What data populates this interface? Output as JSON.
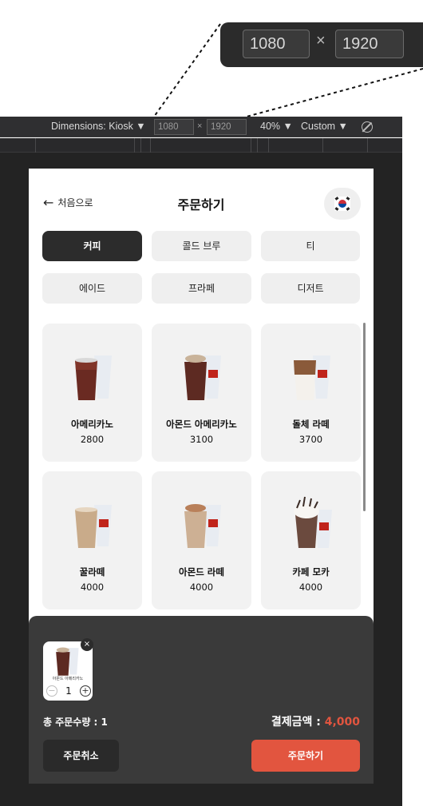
{
  "callout": {
    "width": "1080",
    "times": "×",
    "height": "1920"
  },
  "devtools": {
    "dimensions_label": "Dimensions: Kiosk ▼",
    "width": "1080",
    "times": "×",
    "height": "1920",
    "zoom": "40% ▼",
    "throttle": "Custom ▼"
  },
  "kiosk": {
    "back_label": "처음으로",
    "back_icon": "←",
    "title": "주문하기",
    "language_icon": "korea-flag-icon",
    "tabs": [
      {
        "label": "커피",
        "active": true
      },
      {
        "label": "콜드 브루",
        "active": false
      },
      {
        "label": "티",
        "active": false
      },
      {
        "label": "에이드",
        "active": false
      },
      {
        "label": "프라페",
        "active": false
      },
      {
        "label": "디저트",
        "active": false
      }
    ],
    "products": [
      {
        "name": "아메리카노",
        "price": "2800"
      },
      {
        "name": "아몬드 아메리카노",
        "price": "3100"
      },
      {
        "name": "돌체 라떼",
        "price": "3700"
      },
      {
        "name": "꿀라떼",
        "price": "4000"
      },
      {
        "name": "아몬드 라떼",
        "price": "4000"
      },
      {
        "name": "카페 모카",
        "price": "4000"
      }
    ],
    "cart": {
      "items": [
        {
          "name": "아몬드 아메리카노",
          "qty": "1",
          "minus": "−",
          "plus": "+",
          "remove": "×"
        }
      ],
      "total_count_label": "총 주문수량 : 1",
      "total_amount_label": "결제금액 : ",
      "total_amount_value": "4,000",
      "cancel_label": "주문취소",
      "order_label": "주문하기"
    }
  },
  "colors": {
    "accent": "#e2553f",
    "dark": "#2c2c2c",
    "cart_bg": "#3a3a3a",
    "tab_bg": "#efefef"
  }
}
